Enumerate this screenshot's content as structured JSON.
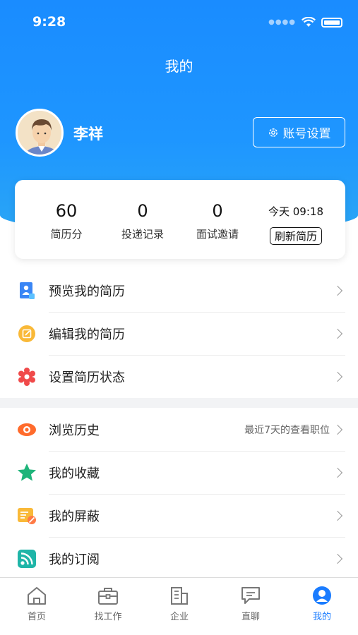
{
  "status_bar": {
    "time": "9:28"
  },
  "nav": {
    "title": "我的"
  },
  "profile": {
    "name": "李祥",
    "account_settings_label": "账号设置"
  },
  "stats": [
    {
      "value": "60",
      "label": "简历分"
    },
    {
      "value": "0",
      "label": "投递记录"
    },
    {
      "value": "0",
      "label": "面试邀请"
    }
  ],
  "refresh": {
    "time": "今天 09:18",
    "button_label": "刷新简历"
  },
  "menu_section_1": [
    {
      "label": "预览我的简历",
      "icon": "resume-preview-icon"
    },
    {
      "label": "编辑我的简历",
      "icon": "edit-resume-icon"
    },
    {
      "label": "设置简历状态",
      "icon": "resume-status-gear-icon"
    }
  ],
  "menu_section_2": [
    {
      "label": "浏览历史",
      "icon": "eye-icon",
      "extra": "最近7天的查看职位"
    },
    {
      "label": "我的收藏",
      "icon": "star-icon"
    },
    {
      "label": "我的屏蔽",
      "icon": "block-icon"
    },
    {
      "label": "我的订阅",
      "icon": "rss-icon"
    }
  ],
  "tabs": [
    {
      "label": "首页",
      "icon": "home-icon"
    },
    {
      "label": "找工作",
      "icon": "briefcase-icon"
    },
    {
      "label": "企业",
      "icon": "building-icon"
    },
    {
      "label": "直聊",
      "icon": "chat-icon"
    },
    {
      "label": "我的",
      "icon": "profile-icon",
      "active": true
    }
  ],
  "colors": {
    "primary": "#1a8cff",
    "active_tab": "#1a7cff",
    "star": "#1fb47a",
    "eye": "#ff6b2c",
    "gear": "#f04a4a"
  }
}
